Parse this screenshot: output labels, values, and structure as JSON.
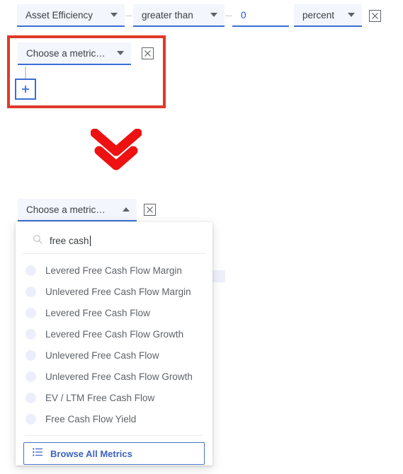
{
  "colors": {
    "accent_blue": "#3b6fd4",
    "highlight_red": "#e03a28",
    "field_bg": "#f3f6fc",
    "value_blue": "#1a56d6",
    "label_gray": "#5f6368",
    "radio_gray": "#eceffb"
  },
  "filter_row": {
    "metric_select": {
      "label": "Asset Efficiency",
      "icon": "chevron-down-icon"
    },
    "operator_select": {
      "label": "greater than",
      "icon": "chevron-down-icon"
    },
    "value_input": {
      "value": "0",
      "placeholder": ""
    },
    "unit_select": {
      "label": "percent",
      "icon": "chevron-down-icon"
    },
    "remove_icon": "close-icon"
  },
  "second_row": {
    "metric_select": {
      "label": "Choose a metric…",
      "icon": "chevron-down-icon"
    },
    "remove_icon": "close-icon",
    "add_button": {
      "label": "+",
      "icon": "plus-icon"
    }
  },
  "flow_arrow": {
    "icon": "double-chevron-down-icon"
  },
  "dropdown": {
    "trigger": {
      "label": "Choose a metric…",
      "icon": "chevron-up-icon"
    },
    "remove_icon": "close-icon",
    "search": {
      "value": "free cash",
      "placeholder": "",
      "icon": "search-icon"
    },
    "options": [
      {
        "label": "Levered Free Cash Flow Margin",
        "selected": false
      },
      {
        "label": "Unlevered Free Cash Flow Margin",
        "selected": false
      },
      {
        "label": "Levered Free Cash Flow",
        "selected": false
      },
      {
        "label": "Levered Free Cash Flow Growth",
        "selected": false
      },
      {
        "label": "Unlevered Free Cash Flow",
        "selected": false
      },
      {
        "label": "Unlevered Free Cash Flow Growth",
        "selected": false
      },
      {
        "label": "EV / LTM Free Cash Flow",
        "selected": false
      },
      {
        "label": "Free Cash Flow Yield",
        "selected": false
      }
    ],
    "browse_all": {
      "label": "Browse All Metrics",
      "icon": "list-icon"
    }
  }
}
